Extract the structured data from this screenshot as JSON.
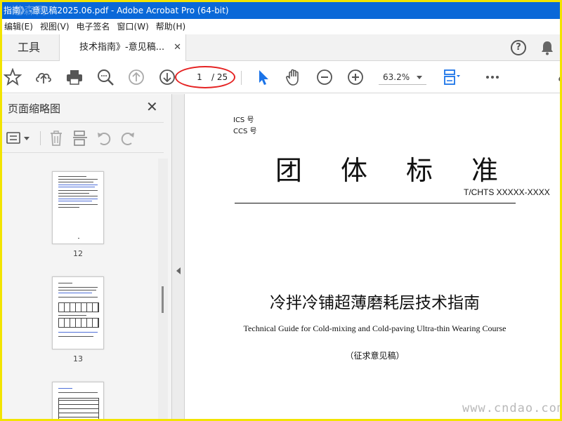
{
  "window": {
    "title": "指南》-意见稿2025.06.pdf - Adobe Acrobat Pro (64-bit)",
    "watermark_top": "道森网"
  },
  "menu": [
    "编辑(E)",
    "视图(V)",
    "电子签名",
    "窗口(W)",
    "帮助(H)"
  ],
  "tabs": {
    "tools_label": "工具",
    "doc_label": "技术指南》-意见稿...",
    "close_glyph": "✕"
  },
  "toolbar": {
    "current_page": "1",
    "total_pages": "/ 25",
    "zoom": "63.2%"
  },
  "thumbnail_panel": {
    "title": "页面缩略图",
    "close_glyph": "✕",
    "pages": [
      "12",
      "13"
    ]
  },
  "document": {
    "ics_label": "ICS 号",
    "ccs_label": "CCS 号",
    "standard_heading": "团体标准",
    "standard_code": "T/CHTS  XXXXX-XXXX",
    "title_cn": "冷拌冷铺超薄磨耗层技术指南",
    "title_en": "Technical Guide for Cold-mixing and Cold-paving Ultra-thin Wearing Course",
    "subtitle": "（征求意见稿）"
  },
  "watermark_bottom": "www.cndao.com",
  "colors": {
    "titlebar": "#0a68d8",
    "border": "#f2e400",
    "highlight_oval": "#e52222",
    "accent_blue": "#1a73e8"
  }
}
